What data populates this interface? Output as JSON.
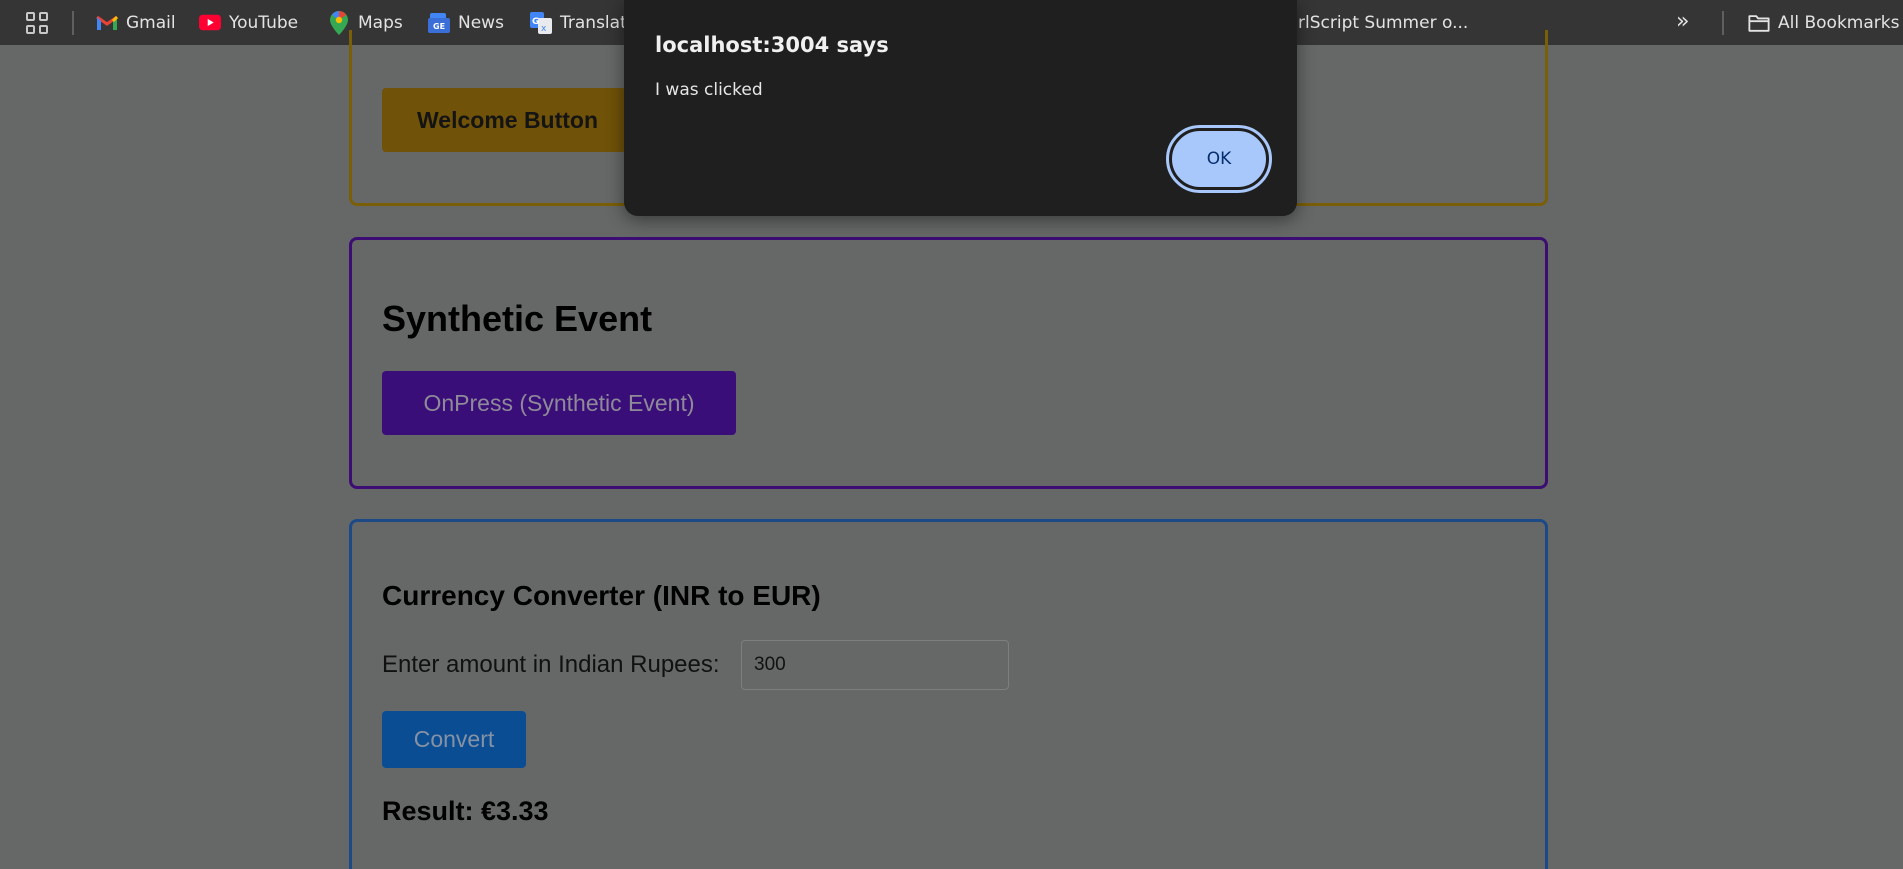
{
  "bookmarks_bar": {
    "items": [
      {
        "label": "Gmail",
        "icon": "gmail-icon"
      },
      {
        "label": "YouTube",
        "icon": "youtube-icon"
      },
      {
        "label": "Maps",
        "icon": "maps-icon"
      },
      {
        "label": "News",
        "icon": "news-icon"
      },
      {
        "label": "Translat",
        "icon": "translate-icon"
      },
      {
        "label": "rlScript Summer o...",
        "icon": ""
      }
    ],
    "more_icon": "chevron-double-right-icon",
    "all_bookmarks_label": "All Bookmarks"
  },
  "page": {
    "welcome_button": "Welcome Button",
    "synthetic_heading": "Synthetic Event",
    "synthetic_button": "OnPress (Synthetic Event)",
    "currency_heading": "Currency Converter (INR to EUR)",
    "amount_label": "Enter amount in Indian Rupees:",
    "amount_value": "300",
    "convert_button": "Convert",
    "result_text": "Result: €3.33"
  },
  "dialog": {
    "title": "localhost:3004 says",
    "message": "I was clicked",
    "ok_label": "OK"
  },
  "colors": {
    "welcome_accent": "#f0b012",
    "synthetic_accent": "#6a1bd6",
    "currency_accent": "#1266d6",
    "dialog_bg": "#1f1f1f",
    "ok_button": "#a8c7fa"
  }
}
